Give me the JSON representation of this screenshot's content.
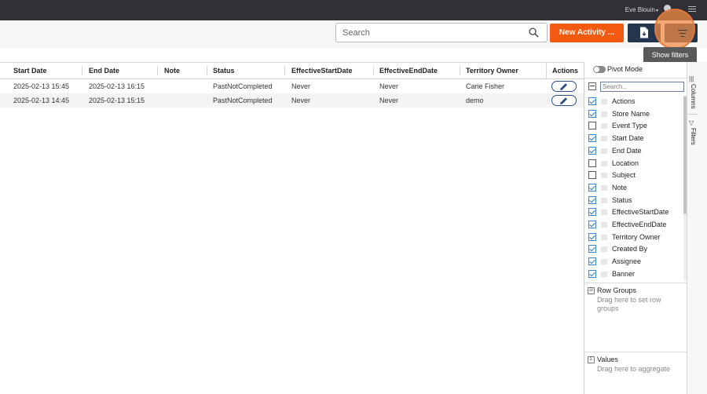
{
  "topbar": {
    "user_name": "Eve Blouin",
    "user_caret": "▾"
  },
  "toolbar": {
    "search_placeholder": "Search",
    "search_icon": "search-icon",
    "new_activity_label": "New Activity ...",
    "export_icon": "file-export-icon",
    "filter_icon": "filter-lines-icon",
    "tooltip": "Show filters"
  },
  "grid": {
    "columns": [
      "Start Date",
      "End Date",
      "Note",
      "Status",
      "EffectiveStartDate",
      "EffectiveEndDate",
      "Territory Owner",
      "Actions"
    ],
    "rows": [
      {
        "start": "2025-02-13 15:45",
        "end": "2025-02-13 16:15",
        "note": "",
        "status": "PastNotCompleted",
        "eff_start": "Never",
        "eff_end": "Never",
        "owner": "Carie Fisher",
        "action_icon": "pencil-icon"
      },
      {
        "start": "2025-02-13 14:45",
        "end": "2025-02-13 15:15",
        "note": "",
        "status": "PastNotCompleted",
        "eff_start": "Never",
        "eff_end": "Never",
        "owner": "demo",
        "action_icon": "pencil-icon"
      }
    ]
  },
  "panel": {
    "pivot_label": "Pivot Mode",
    "search_placeholder": "Search...",
    "columns": [
      {
        "label": "Actions",
        "checked": true
      },
      {
        "label": "Store Name",
        "checked": true
      },
      {
        "label": "Event Type",
        "checked": false
      },
      {
        "label": "Start Date",
        "checked": true
      },
      {
        "label": "End Date",
        "checked": true
      },
      {
        "label": "Location",
        "checked": false
      },
      {
        "label": "Subject",
        "checked": false
      },
      {
        "label": "Note",
        "checked": true
      },
      {
        "label": "Status",
        "checked": true
      },
      {
        "label": "EffectiveStartDate",
        "checked": true
      },
      {
        "label": "EffectiveEndDate",
        "checked": true
      },
      {
        "label": "Territory Owner",
        "checked": true
      },
      {
        "label": "Created By",
        "checked": true
      },
      {
        "label": "Assignee",
        "checked": true
      },
      {
        "label": "Banner",
        "checked": true
      }
    ],
    "row_groups": {
      "title": "Row Groups",
      "hint": "Drag here to set row groups"
    },
    "values": {
      "title": "Values",
      "hint": "Drag here to aggregate"
    }
  },
  "sidetabs": {
    "columns": "Columns",
    "filters": "Filters"
  },
  "colors": {
    "accent": "#f25a12",
    "navy": "#23364e",
    "check": "#2d7cc4"
  }
}
